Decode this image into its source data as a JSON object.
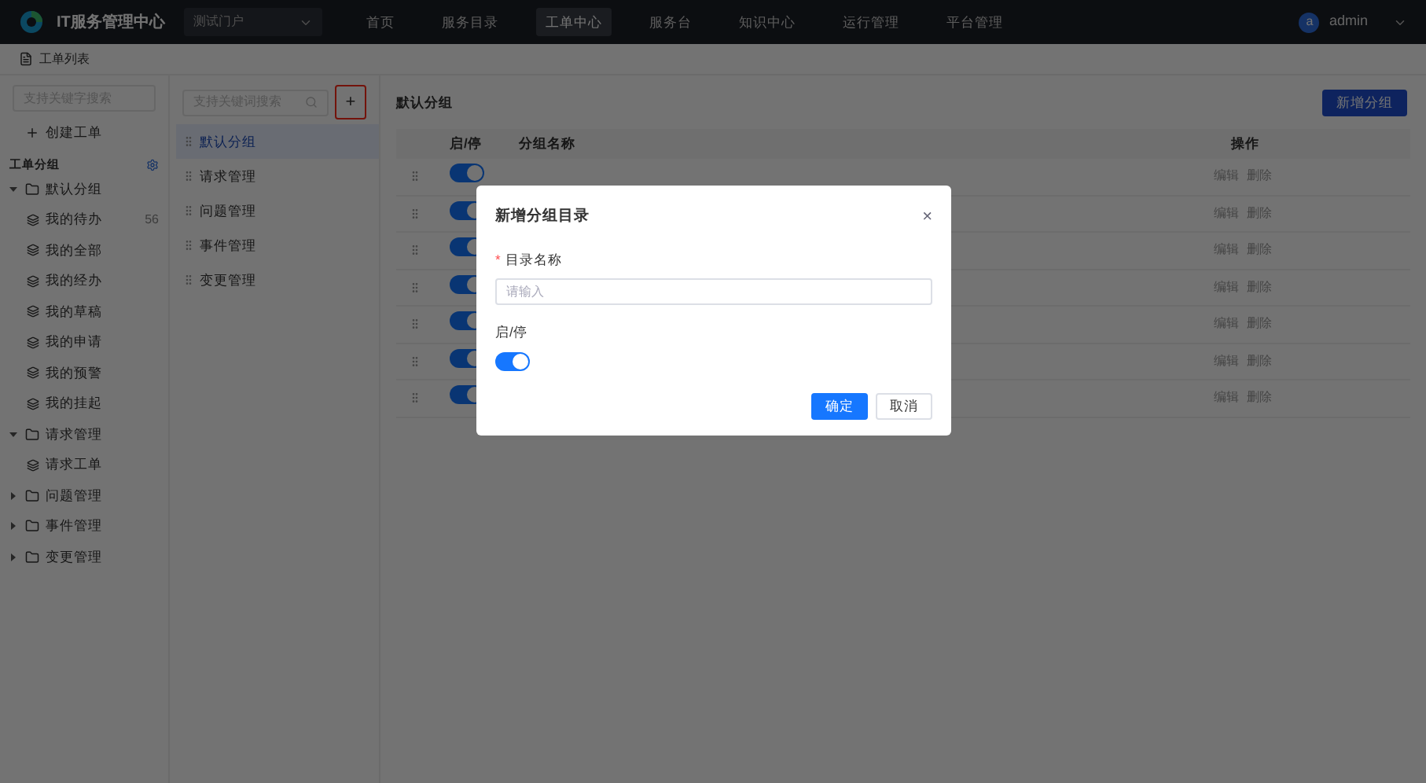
{
  "header": {
    "app_name": "IT服务管理中心",
    "portal_select": "测试门户",
    "nav": [
      {
        "label": "首页",
        "selected": false
      },
      {
        "label": "服务目录",
        "selected": false
      },
      {
        "label": "工单中心",
        "selected": true
      },
      {
        "label": "服务台",
        "selected": false
      },
      {
        "label": "知识中心",
        "selected": false
      },
      {
        "label": "运行管理",
        "selected": false
      },
      {
        "label": "平台管理",
        "selected": false
      }
    ],
    "user": "admin",
    "avatar_letter": "a"
  },
  "breadcrumb": "工单列表",
  "sidebar": {
    "search_placeholder": "支持关键字搜索",
    "create_button": "创建工单",
    "section_title": "工单分组",
    "tree": [
      {
        "label": "默认分组",
        "expanded": true,
        "children": [
          {
            "label": "我的待办",
            "count": "56"
          },
          {
            "label": "我的全部"
          },
          {
            "label": "我的经办"
          },
          {
            "label": "我的草稿"
          },
          {
            "label": "我的申请"
          },
          {
            "label": "我的预警"
          },
          {
            "label": "我的挂起"
          }
        ]
      },
      {
        "label": "请求管理",
        "expanded": true,
        "children": [
          {
            "label": "请求工单"
          }
        ]
      },
      {
        "label": "问题管理",
        "expanded": false
      },
      {
        "label": "事件管理",
        "expanded": false
      },
      {
        "label": "变更管理",
        "expanded": false
      }
    ]
  },
  "groups": {
    "search_placeholder": "支持关键词搜索",
    "add_button": "+",
    "items": [
      {
        "label": "默认分组",
        "selected": true
      },
      {
        "label": "请求管理",
        "selected": false
      },
      {
        "label": "问题管理",
        "selected": false
      },
      {
        "label": "事件管理",
        "selected": false
      },
      {
        "label": "变更管理",
        "selected": false
      }
    ]
  },
  "main": {
    "title": "默认分组",
    "add_button": "新增分组",
    "columns": [
      "启/停",
      "分组名称",
      "操作"
    ],
    "rows": [
      {
        "enabled": true,
        "actions": [
          "编辑",
          "删除"
        ]
      },
      {
        "enabled": true,
        "actions": [
          "编辑",
          "删除"
        ]
      },
      {
        "enabled": true,
        "actions": [
          "编辑",
          "删除"
        ]
      },
      {
        "enabled": true,
        "actions": [
          "编辑",
          "删除"
        ]
      },
      {
        "enabled": true,
        "actions": [
          "编辑",
          "删除"
        ]
      },
      {
        "enabled": true,
        "actions": [
          "编辑",
          "删除"
        ]
      },
      {
        "enabled": true,
        "actions": [
          "编辑",
          "删除"
        ]
      }
    ]
  },
  "dialog": {
    "title": "新增分组目录",
    "close": "×",
    "name_label": "目录名称",
    "required_mark": "*",
    "name_placeholder": "请输入",
    "toggle_label": "启/停",
    "toggle_on": true,
    "confirm": "确定",
    "cancel": "取消"
  }
}
